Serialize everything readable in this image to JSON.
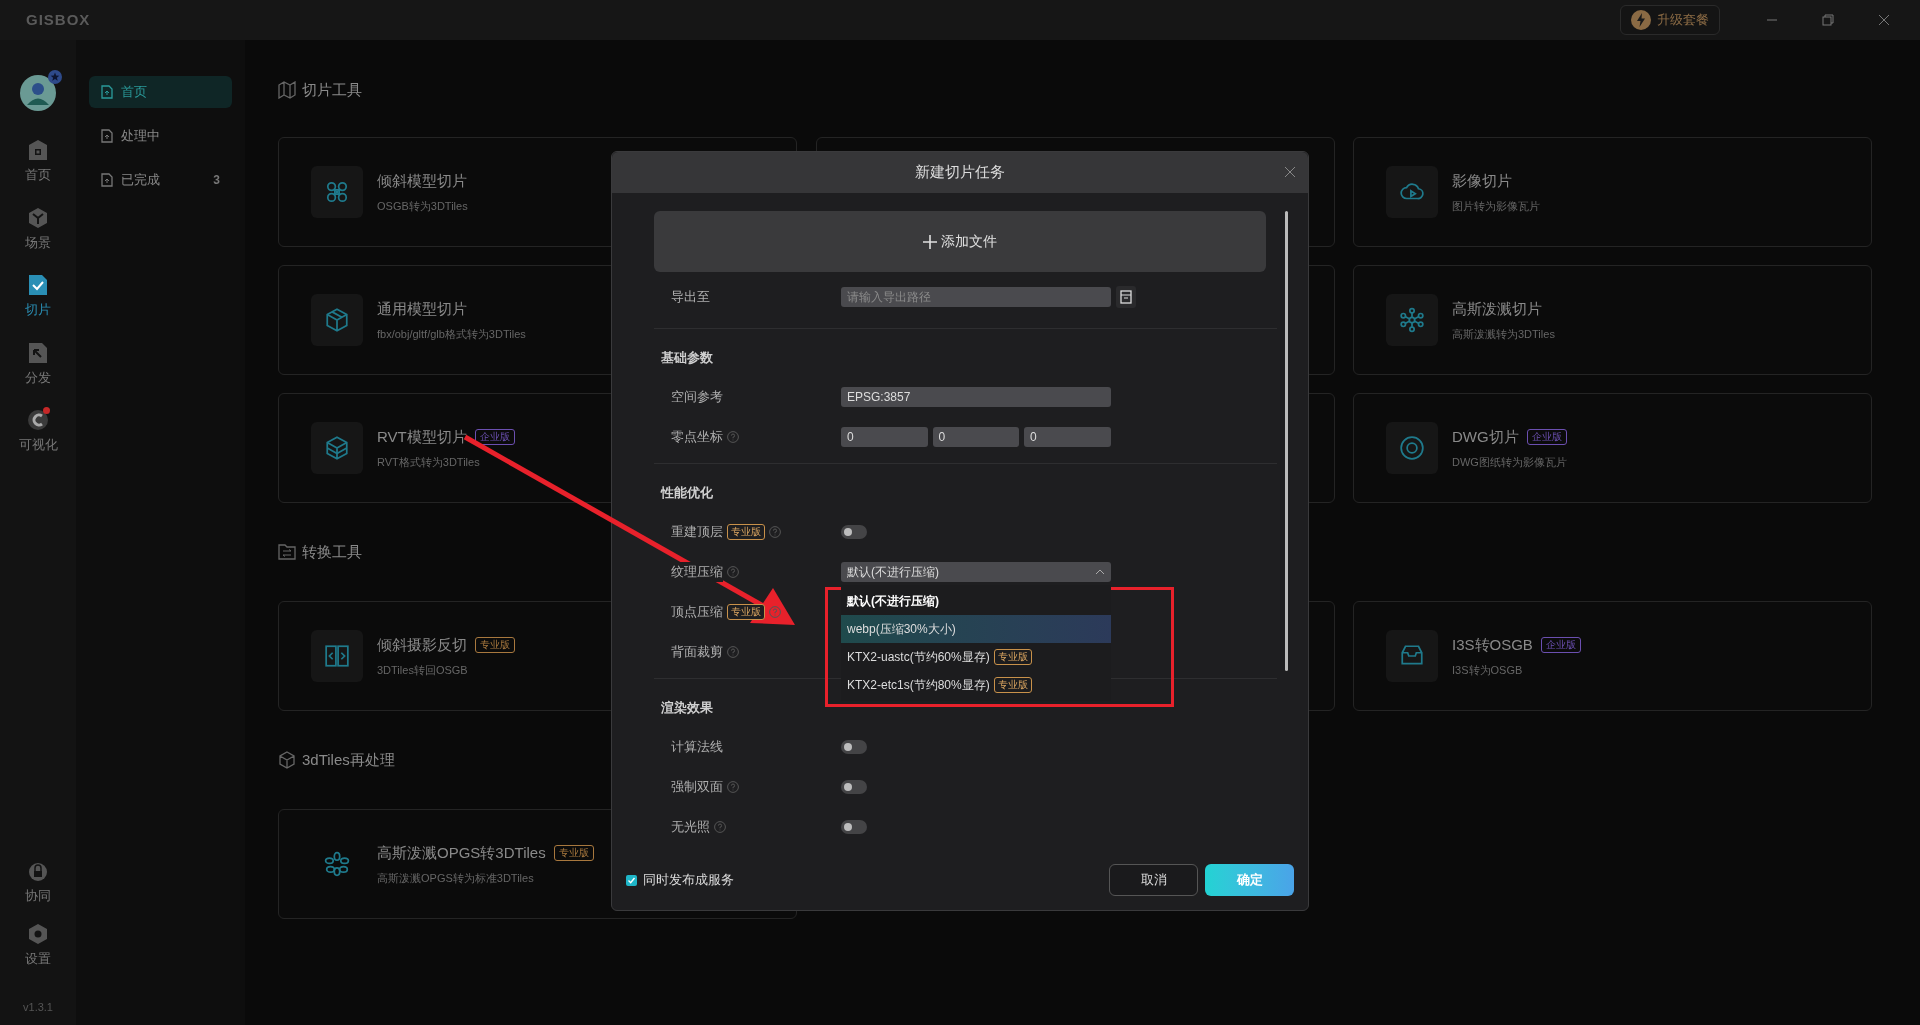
{
  "title_bar": {
    "logo": "GISBOX",
    "upgrade_button": "升级套餐"
  },
  "nav_rail": {
    "items": [
      {
        "label": "首页",
        "selected": false,
        "alert": false
      },
      {
        "label": "场景",
        "selected": false,
        "alert": false
      },
      {
        "label": "切片",
        "selected": true,
        "alert": false
      },
      {
        "label": "分发",
        "selected": false,
        "alert": false
      },
      {
        "label": "可视化",
        "selected": false,
        "alert": true
      }
    ],
    "bottom_items": [
      {
        "label": "协同"
      },
      {
        "label": "设置"
      }
    ],
    "version": "v1.3.1"
  },
  "task_sidebar": {
    "items": [
      {
        "label": "首页",
        "selected": true
      },
      {
        "label": "处理中",
        "selected": false
      },
      {
        "label": "已完成",
        "count": "3",
        "selected": false
      }
    ]
  },
  "sections": [
    {
      "title": "切片工具",
      "cards": [
        {
          "kind": "tool",
          "title": "倾斜模型切片",
          "description": "OSGB转为3DTiles"
        },
        {
          "kind": "covered"
        },
        {
          "kind": "tool",
          "title": "影像切片",
          "description": "图片转为影像瓦片"
        },
        {
          "kind": "tool",
          "title": "通用模型切片",
          "description": "fbx/obj/gltf/glb格式转为3DTiles"
        },
        {
          "kind": "covered"
        },
        {
          "kind": "tool",
          "title": "高斯泼溅切片",
          "description": "高斯泼溅转为3DTiles"
        },
        {
          "kind": "tool",
          "title": "RVT模型切片",
          "description": "RVT格式转为3DTiles",
          "badge": {
            "label": "企业版",
            "color": "#6b4fb0"
          }
        },
        {
          "kind": "covered"
        },
        {
          "kind": "tool",
          "title": "DWG切片",
          "description": "DWG图纸转为影像瓦片",
          "badge": {
            "label": "企业版",
            "color": "#6b4fb0"
          }
        }
      ]
    },
    {
      "title": "转换工具",
      "cards": [
        {
          "kind": "tool",
          "title": "倾斜摄影反切",
          "description": "3DTiles转回OSGB",
          "badge": {
            "label": "专业版",
            "color": "#a8783e"
          }
        },
        {
          "kind": "covered"
        },
        {
          "kind": "tool",
          "title": "I3S转OSGB",
          "description": "I3S转为OSGB",
          "badge": {
            "label": "企业版",
            "color": "#6b4fb0"
          }
        }
      ]
    },
    {
      "title": "3dTiles再处理",
      "cards": [
        {
          "kind": "tool",
          "title": "高斯泼溅OPGS转3DTiles",
          "description": "高斯泼溅OPGS转为标准3DTiles",
          "badge": {
            "label": "专业版",
            "color": "#a8783e"
          }
        }
      ]
    }
  ],
  "dialog": {
    "title": "新建切片任务",
    "add_file_button": "添加文件",
    "output": {
      "label": "导出至",
      "placeholder": "请输入导出路径"
    },
    "groups": [
      {
        "title": "基础参数",
        "rows": [
          {
            "kind": "text",
            "label": "空间参考",
            "help": false,
            "value": "EPSG:3857"
          },
          {
            "kind": "triple",
            "label": "零点坐标",
            "help": true,
            "values": [
              "0",
              "0",
              "0"
            ]
          }
        ]
      },
      {
        "title": "性能优化",
        "rows": [
          {
            "kind": "toggle",
            "label": "重建顶层",
            "badge": "专业版",
            "help": true,
            "on": false
          },
          {
            "kind": "select",
            "label": "纹理压缩",
            "help": true,
            "value": "默认(不进行压缩)",
            "expanded": true,
            "options": [
              {
                "label": "默认(不进行压缩)",
                "selected": true,
                "hovered": false
              },
              {
                "label": "webp(压缩30%大小)",
                "selected": false,
                "hovered": true
              },
              {
                "label": "KTX2-uastc(节约60%显存)",
                "selected": false,
                "hovered": false,
                "badge": "专业版"
              },
              {
                "label": "KTX2-etc1s(节约80%显存)",
                "selected": false,
                "hovered": false,
                "badge": "专业版"
              }
            ]
          },
          {
            "kind": "plain",
            "label": "顶点压缩",
            "badge": "专业版",
            "help": true
          },
          {
            "kind": "plain",
            "label": "背面裁剪",
            "help": true
          }
        ]
      },
      {
        "title": "渲染效果",
        "rows": [
          {
            "kind": "toggle",
            "label": "计算法线",
            "help": false,
            "on": false
          },
          {
            "kind": "toggle",
            "label": "强制双面",
            "help": true,
            "on": false
          },
          {
            "kind": "toggle",
            "label": "无光照",
            "help": true,
            "on": false
          }
        ]
      }
    ],
    "footer": {
      "publish_checkbox": {
        "label": "同时发布成服务",
        "checked": true
      },
      "cancel_button": "取消",
      "confirm_button": "确定"
    }
  }
}
